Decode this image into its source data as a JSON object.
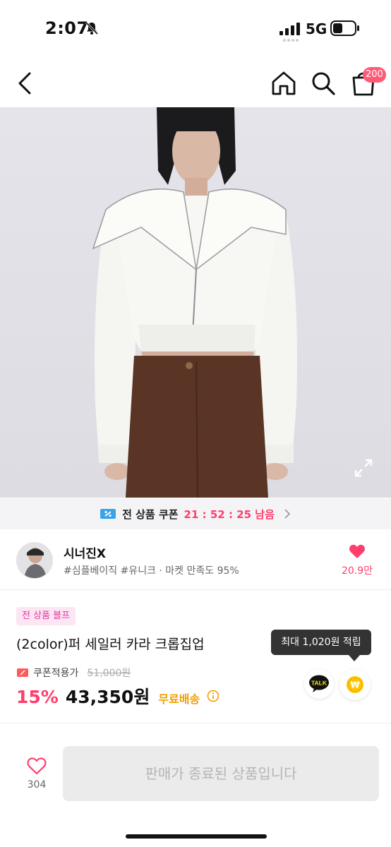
{
  "status_bar": {
    "time": "2:07",
    "network": "5G"
  },
  "header": {
    "cart_count": "200"
  },
  "icons": {
    "back": "chevron-left-icon",
    "home": "home-icon",
    "search": "search-icon",
    "cart": "shopping-bag-icon",
    "expand": "expand-icon",
    "like": "heart-icon",
    "talk": "kakao-talk-icon",
    "points": "won-coin-icon",
    "info": "info-icon"
  },
  "coupon_bar": {
    "label": "전 상품 쿠폰",
    "timer": "21 : 52 : 25 남음"
  },
  "shop": {
    "name": "시너진X",
    "tags": "#심플베이직 #유니크 · 마켓 만족도 95%",
    "like_count": "20.9만"
  },
  "product": {
    "badge": "전 상품 블프",
    "title": "(2color)퍼 세일러 카라 크롭집업",
    "coupon_price_label": "쿠폰적용가",
    "original_price": "51,000원",
    "discount_rate": "15%",
    "final_price": "43,350원",
    "shipping": "무료배송"
  },
  "tooltip": {
    "text": "최대 1,020원 적립"
  },
  "talk_button": {
    "label": "TALK"
  },
  "bottom_bar": {
    "wish_count": "304",
    "buy_label": "판매가 종료된 상품입니다"
  },
  "colors": {
    "accent": "#ff3e6c",
    "badge_bg": "#fde6f3",
    "badge_text": "#e0399f",
    "shipping": "#f0a000",
    "cart_badge": "#ff5a76"
  }
}
